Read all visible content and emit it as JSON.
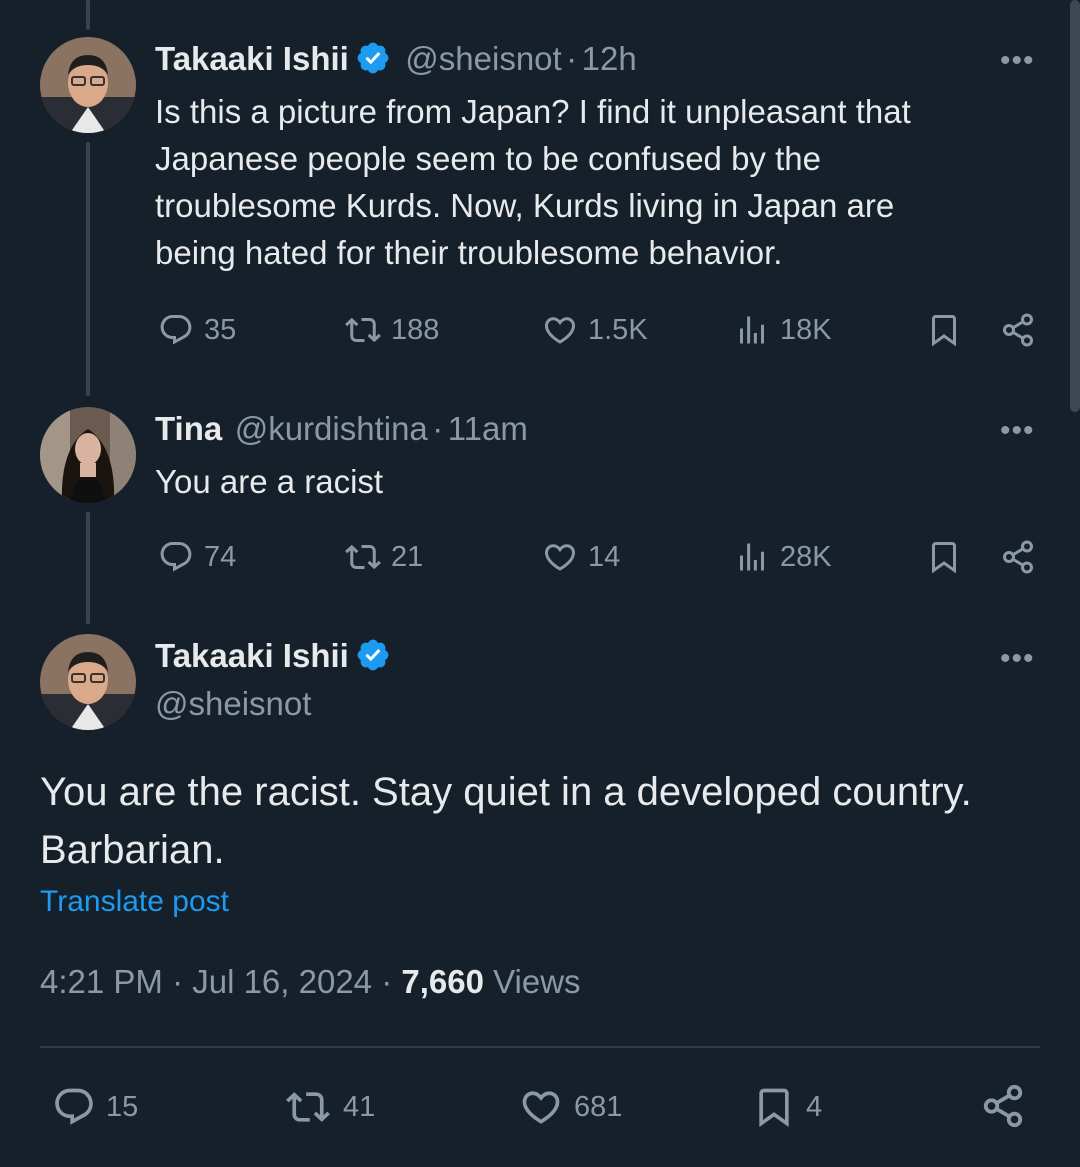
{
  "tweets": [
    {
      "name": "Takaaki Ishii",
      "handle": "@sheisnot",
      "sep": "·",
      "time": "12h",
      "text_lines": [
        "Is this a picture from Japan? I find it unpleasant that",
        "Japanese people seem to be confused by the",
        "troublesome Kurds. Now, Kurds living in Japan are",
        "being hated for their troublesome behavior."
      ],
      "replies": "35",
      "reposts": "188",
      "likes": "1.5K",
      "views": "18K"
    },
    {
      "name": "Tina",
      "handle": "@kurdishtina",
      "sep": "·",
      "time": "11am",
      "text_lines": [
        "You are a racist"
      ],
      "replies": "74",
      "reposts": "21",
      "likes": "14",
      "views": "28K"
    }
  ],
  "main": {
    "name": "Takaaki Ishii",
    "handle": "@sheisnot",
    "text_lines": [
      "You are the racist. Stay quiet in a developed country.",
      "Barbarian."
    ],
    "translate": "Translate post",
    "timestamp": "4:21 PM · Jul 16, 2024 · ",
    "views_count": "7,660",
    "views_label": " Views",
    "replies": "15",
    "reposts": "41",
    "likes": "681",
    "bookmarks": "4"
  },
  "more_label": "•••",
  "colors": {
    "background": "#15202b",
    "accent": "#1d9bf0",
    "muted": "#8b98a5",
    "text": "#e7e9ea"
  },
  "icons": [
    "reply-icon",
    "repost-icon",
    "like-icon",
    "views-icon",
    "bookmark-icon",
    "share-icon",
    "verified-badge-icon",
    "more-icon"
  ]
}
